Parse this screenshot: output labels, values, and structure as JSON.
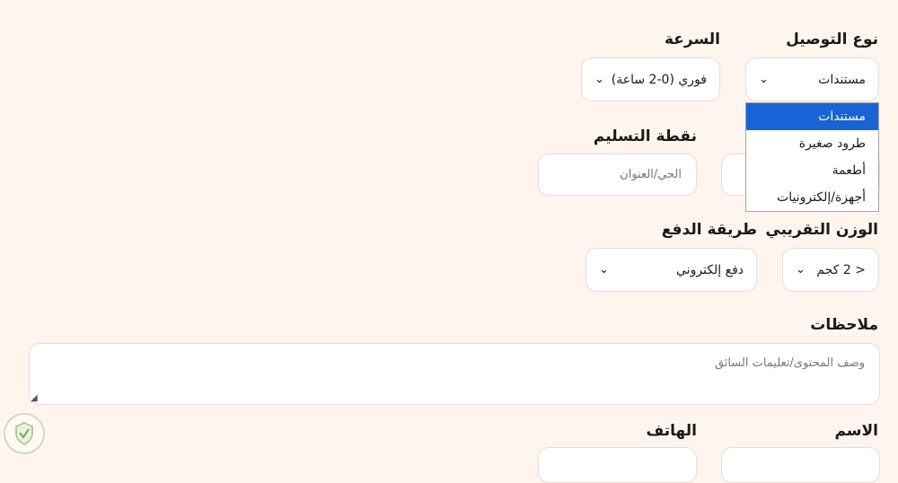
{
  "fields": {
    "delivery_type": {
      "label": "نوع التوصيل",
      "value": "مستندات"
    },
    "speed": {
      "label": "السرعة",
      "value": "فوري (0-2 ساعة)"
    },
    "dropoff": {
      "label": "نقطة التسليم",
      "placeholder": "الحي/العنوان"
    },
    "weight": {
      "label": "الوزن التقريبي",
      "value": "< 2 كجم"
    },
    "payment": {
      "label": "طريقة الدفع",
      "value": "دفع إلكتروني"
    },
    "notes": {
      "label": "ملاحظات",
      "placeholder": "وصف المحتوى/تعليمات السائق"
    },
    "name": {
      "label": "الاسم"
    },
    "phone": {
      "label": "الهاتف"
    }
  },
  "dropdown": {
    "options": [
      "مستندات",
      "طرود صغيرة",
      "أطعمة",
      "أجهزة/إلكترونيات"
    ],
    "selected_index": 0
  },
  "colors": {
    "background": "#fdf5ee",
    "highlight": "#1a63d6",
    "border": "#e6ddd5"
  },
  "icons": {
    "chevron": "chevron-down-icon",
    "logo": "shield-logo"
  }
}
